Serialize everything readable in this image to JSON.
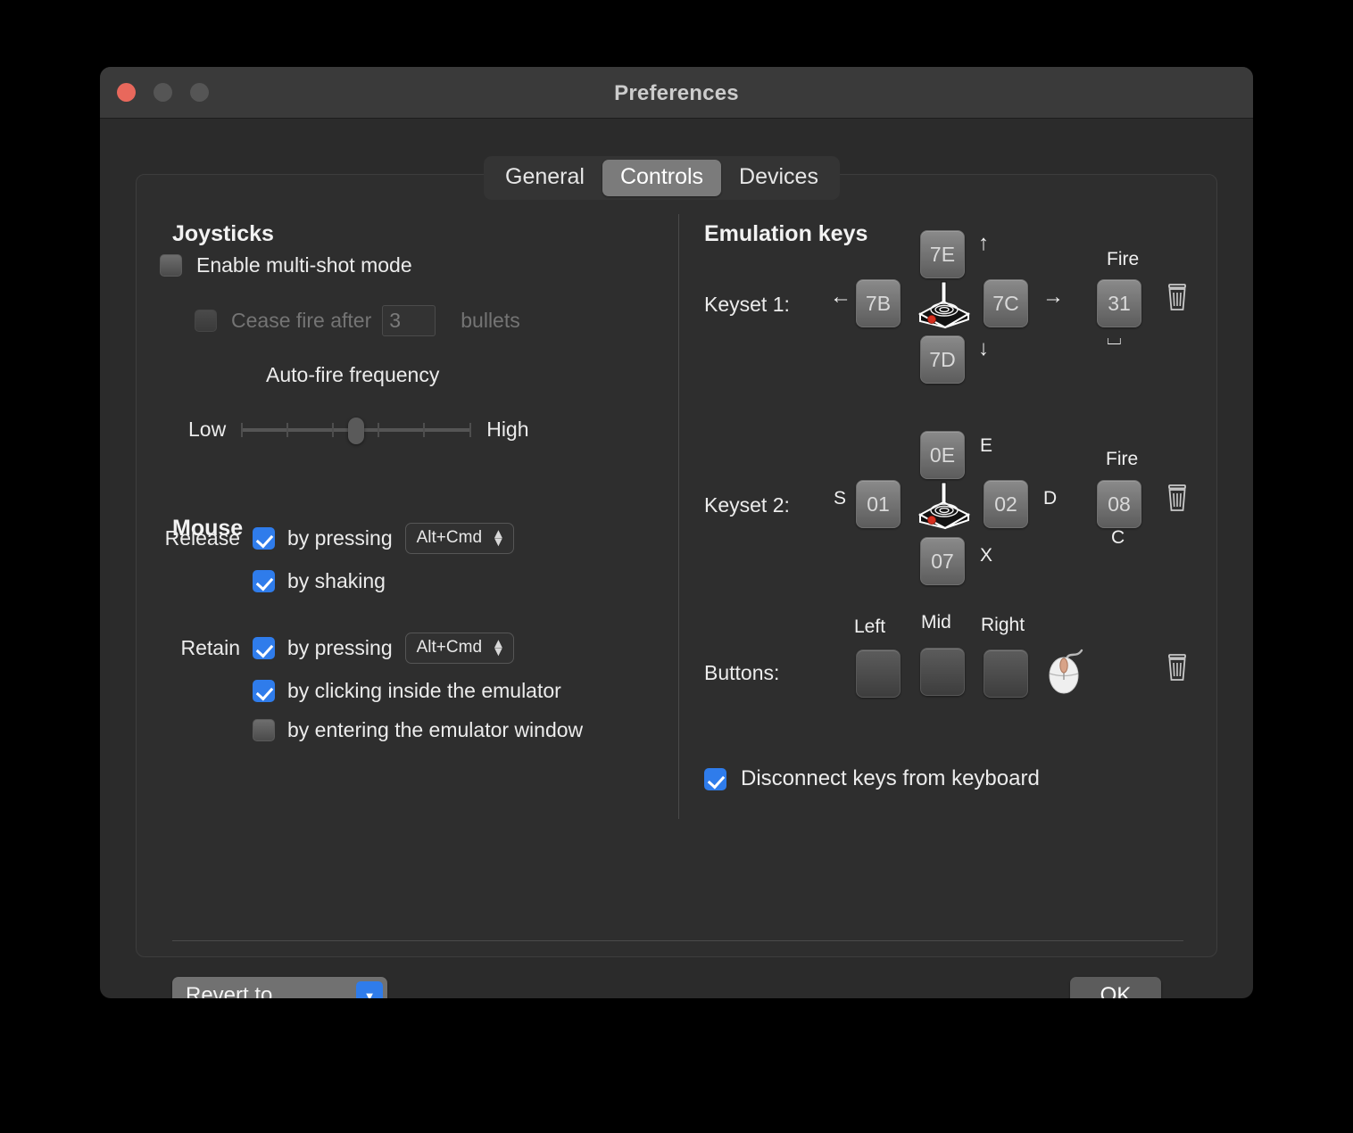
{
  "window": {
    "title": "Preferences",
    "traffic_lights": [
      "close",
      "minimize",
      "zoom"
    ]
  },
  "tabs": [
    {
      "label": "General",
      "active": false
    },
    {
      "label": "Controls",
      "active": true
    },
    {
      "label": "Devices",
      "active": false
    }
  ],
  "joysticks": {
    "title": "Joysticks",
    "multi_shot": {
      "label": "Enable multi-shot mode",
      "checked": false
    },
    "cease_fire": {
      "label_before": "Cease fire after",
      "bullets_value": "3",
      "label_after": "bullets",
      "checked": false,
      "enabled": false
    },
    "auto_fire": {
      "label": "Auto-fire frequency",
      "low_label": "Low",
      "high_label": "High",
      "ticks": 6,
      "value_percent": 50
    }
  },
  "mouse": {
    "title": "Mouse",
    "release": {
      "row_label": "Release",
      "by_pressing": {
        "label": "by pressing",
        "checked": true,
        "modifier": "Alt+Cmd"
      },
      "by_shaking": {
        "label": "by shaking",
        "checked": true
      }
    },
    "retain": {
      "row_label": "Retain",
      "by_pressing": {
        "label": "by pressing",
        "checked": true,
        "modifier": "Alt+Cmd"
      },
      "by_clicking": {
        "label": "by clicking inside the emulator",
        "checked": true
      },
      "by_entering": {
        "label": "by entering the emulator window",
        "checked": false
      }
    }
  },
  "emulation_keys": {
    "title": "Emulation keys",
    "keyset1": {
      "row_label": "Keyset 1:",
      "up": {
        "code": "7E",
        "hint": "↑"
      },
      "left": {
        "code": "7B",
        "hint": "←"
      },
      "right": {
        "code": "7C",
        "hint": "→"
      },
      "down": {
        "code": "7D",
        "hint": "↓"
      },
      "fire": {
        "code": "31",
        "label": "Fire",
        "hint": "⌴"
      },
      "clear_tooltip": "trash"
    },
    "keyset2": {
      "row_label": "Keyset 2:",
      "up": {
        "code": "0E",
        "hint": "E"
      },
      "left": {
        "code": "01",
        "hint": "S"
      },
      "right": {
        "code": "02",
        "hint": "D"
      },
      "down": {
        "code": "07",
        "hint": "X"
      },
      "fire": {
        "code": "08",
        "label": "Fire",
        "hint": "C"
      },
      "clear_tooltip": "trash"
    },
    "buttons": {
      "row_label": "Buttons:",
      "columns": [
        "Left",
        "Mid",
        "Right"
      ],
      "values": [
        "",
        "",
        ""
      ],
      "clear_tooltip": "trash"
    },
    "disconnect": {
      "label": "Disconnect keys from keyboard",
      "checked": true
    }
  },
  "footer": {
    "revert_label": "Revert to...",
    "ok_label": "OK"
  },
  "colors": {
    "accent_blue": "#2f7ceb",
    "close_red": "#e8685c",
    "window_bg": "#2b2b2b",
    "panel_bg": "#2e2e2e",
    "titlebar_bg": "#3a3a3a",
    "keycap_top": "#8a8a8a",
    "keycap_bottom": "#5c5c5c",
    "fire_red": "#d42f1f"
  }
}
